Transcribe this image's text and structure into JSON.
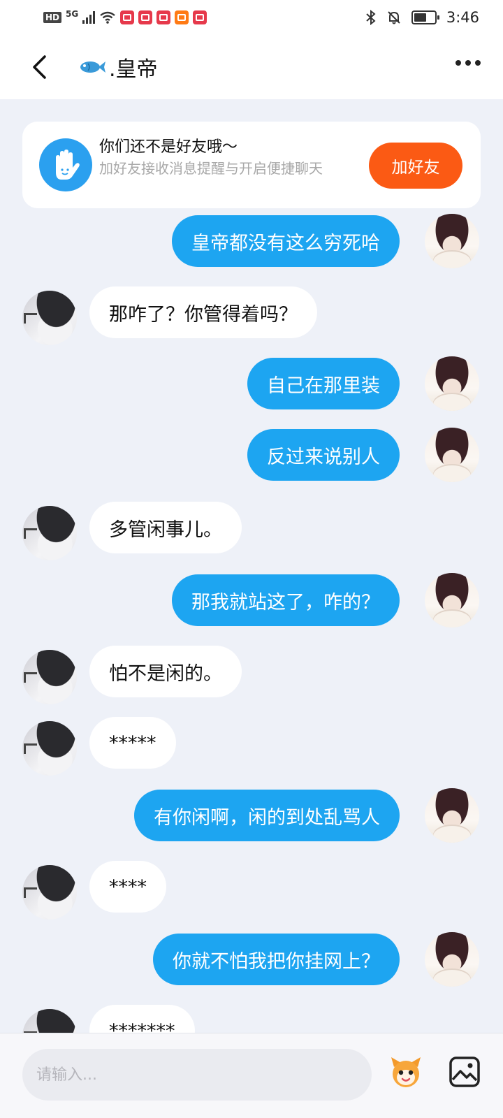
{
  "status_bar": {
    "hd": "HD",
    "network": "5G",
    "time": "3:46"
  },
  "header": {
    "title": ".皇帝",
    "title_icon": "fish-icon",
    "back_icon": "chevron-left-icon",
    "more_icon": "more-dots-icon"
  },
  "friend_banner": {
    "title": "你们还不是好友哦～",
    "description": "加好友接收消息提醒与开启便捷聊天",
    "button_label": "加好友",
    "icon": "hand-icon"
  },
  "messages": [
    {
      "side": "out",
      "text": "皇帝都没有这么穷死哈"
    },
    {
      "side": "in",
      "text": "那咋了？你管得着吗？"
    },
    {
      "side": "out",
      "text": "自己在那里装"
    },
    {
      "side": "out",
      "text": "反过来说别人"
    },
    {
      "side": "in",
      "text": "多管闲事儿。"
    },
    {
      "side": "out",
      "text": "那我就站这了，咋的？"
    },
    {
      "side": "in",
      "text": "怕不是闲的。"
    },
    {
      "side": "in",
      "text": "*****"
    },
    {
      "side": "out",
      "text": "有你闲啊，闲的到处乱骂人"
    },
    {
      "side": "in",
      "text": "****"
    },
    {
      "side": "out",
      "text": "你就不怕我把你挂网上？"
    },
    {
      "side": "in",
      "text": "*******"
    }
  ],
  "input_bar": {
    "placeholder": "请输入...",
    "emoji_icon": "emoji-mascot-icon",
    "image_icon": "image-icon"
  },
  "colors": {
    "outgoing_bubble": "#1da5f1",
    "add_friend_button": "#fb5a14",
    "background": "#eef1f8"
  }
}
